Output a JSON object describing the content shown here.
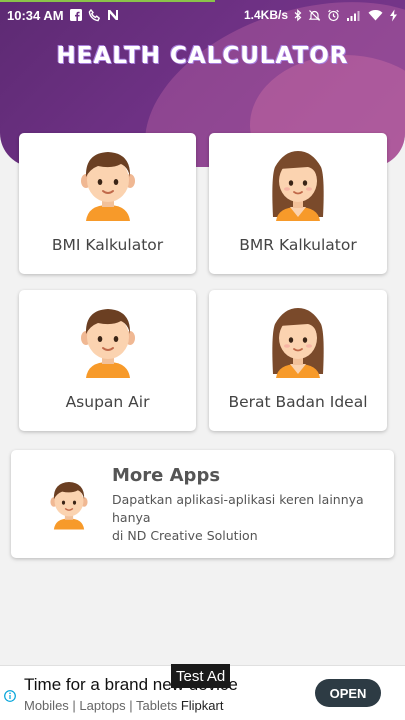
{
  "statusbar": {
    "time": "10:34 AM",
    "net_speed": "1.4KB/s",
    "icons": [
      "facebook-icon",
      "phone-icon",
      "n-app-icon",
      "bluetooth-icon",
      "mute-icon",
      "alarm-icon",
      "signal-icon",
      "wifi-icon",
      "charging-icon"
    ]
  },
  "header": {
    "title": "HEALTH CALCULATOR"
  },
  "menu": {
    "bmi": {
      "label": "BMI Kalkulator",
      "avatar": "boy-avatar-icon"
    },
    "bmr": {
      "label": "BMR Kalkulator",
      "avatar": "girl-avatar-icon"
    },
    "air": {
      "label": "Asupan Air",
      "avatar": "boy-avatar-icon"
    },
    "ideal": {
      "label": "Berat Badan Ideal",
      "avatar": "girl-avatar-icon"
    }
  },
  "more_apps": {
    "title": "More Apps",
    "desc_line1": "Dapatkan aplikasi-aplikasi keren lainnya",
    "desc_line2": "hanya",
    "desc_line3": "di ND Creative Solution"
  },
  "ad": {
    "badge": "Test Ad",
    "headline": "Time for a brand new device",
    "sub_prefix": "Mobiles | Laptops | Tablets",
    "sub_brand": "Flipkart",
    "cta": "OPEN"
  },
  "colors": {
    "header_start": "#5d2a73",
    "header_end": "#7b3a8e",
    "ad_button": "#2d3b44"
  }
}
